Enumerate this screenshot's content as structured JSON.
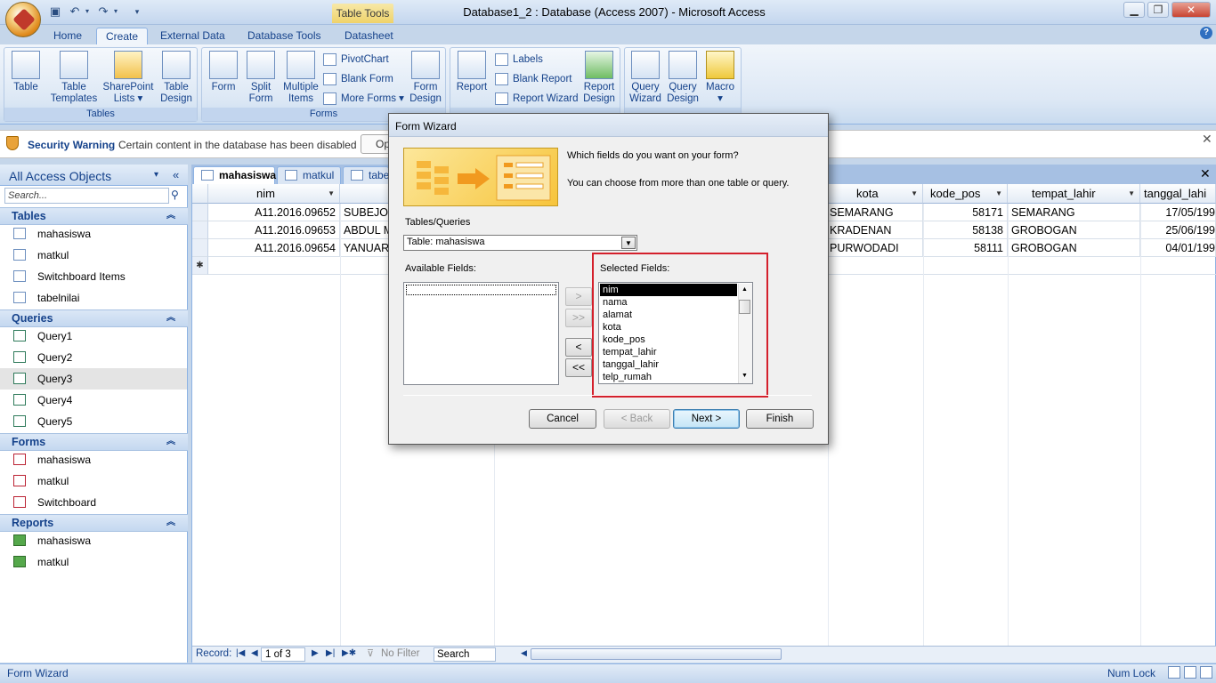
{
  "title_bar": {
    "context_tab": "Table Tools",
    "window_title": "Database1_2 : Database (Access 2007) - Microsoft Access"
  },
  "ribbon_tabs": [
    "Home",
    "Create",
    "External Data",
    "Database Tools",
    "Datasheet"
  ],
  "ribbon": {
    "tables": {
      "label": "Tables",
      "buttons": [
        {
          "l1": "Table",
          "l2": ""
        },
        {
          "l1": "Table",
          "l2": "Templates ▾"
        },
        {
          "l1": "SharePoint",
          "l2": "Lists ▾"
        },
        {
          "l1": "Table",
          "l2": "Design"
        }
      ]
    },
    "forms": {
      "label": "Forms",
      "big": [
        {
          "l1": "Form",
          "l2": ""
        },
        {
          "l1": "Split",
          "l2": "Form"
        },
        {
          "l1": "Multiple",
          "l2": "Items"
        }
      ],
      "small": [
        "PivotChart",
        "Blank Form",
        "More Forms ▾"
      ],
      "design": {
        "l1": "Form",
        "l2": "Design"
      }
    },
    "reports": {
      "big": {
        "l1": "Report",
        "l2": ""
      },
      "small": [
        "Labels",
        "Blank Report",
        "Report Wizard"
      ],
      "design": {
        "l1": "Report",
        "l2": "Design"
      }
    },
    "other": {
      "buttons": [
        {
          "l1": "Query",
          "l2": "Wizard"
        },
        {
          "l1": "Query",
          "l2": "Design"
        },
        {
          "l1": "Macro",
          "l2": "▾"
        }
      ]
    }
  },
  "security_bar": {
    "title": "Security Warning",
    "message": "Certain content in the database has been disabled",
    "options_button": "Op"
  },
  "nav_pane": {
    "title": "All Access Objects",
    "search_placeholder": "Search...",
    "sections": {
      "tables": {
        "label": "Tables",
        "items": [
          "mahasiswa",
          "matkul",
          "Switchboard Items",
          "tabelnilai"
        ]
      },
      "queries": {
        "label": "Queries",
        "items": [
          "Query1",
          "Query2",
          "Query3",
          "Query4",
          "Query5"
        ]
      },
      "forms": {
        "label": "Forms",
        "items": [
          "mahasiswa",
          "matkul",
          "Switchboard"
        ]
      },
      "reports": {
        "label": "Reports",
        "items": [
          "mahasiswa",
          "matkul"
        ]
      }
    }
  },
  "doc_tabs": [
    "mahasiswa",
    "matkul",
    "tabe"
  ],
  "datasheet": {
    "columns": {
      "nim": "nim",
      "kota": "kota",
      "kode_pos": "kode_pos",
      "tempat_lahir": "tempat_lahir",
      "tanggal_lahir": "tanggal_lahi"
    },
    "rows": [
      {
        "nim": "A11.2016.09652",
        "nama": "SUBEJO",
        "kota": "SEMARANG",
        "kode_pos": "58171",
        "tempat_lahir": "SEMARANG",
        "tanggal_lahir": "17/05/199"
      },
      {
        "nim": "A11.2016.09653",
        "nama": "ABDUL M",
        "kota": "KRADENAN",
        "kode_pos": "58138",
        "tempat_lahir": "GROBOGAN",
        "tanggal_lahir": "25/06/199"
      },
      {
        "nim": "A11.2016.09654",
        "nama": "YANUAR",
        "kota": "PURWODADI",
        "kode_pos": "58111",
        "tempat_lahir": "GROBOGAN",
        "tanggal_lahir": "04/01/199"
      }
    ],
    "new_row_marker": "✱"
  },
  "record_nav": {
    "label": "Record:",
    "position": "1 of 3",
    "filter": "No Filter",
    "search": "Search"
  },
  "status_bar": {
    "left": "Form Wizard",
    "numlock": "Num Lock"
  },
  "dialog": {
    "title": "Form Wizard",
    "question": "Which fields do you want on your form?",
    "hint": "You can choose from more than one table or query.",
    "tables_queries_label": "Tables/Queries",
    "tables_queries_value": "Table: mahasiswa",
    "available_label": "Available Fields:",
    "selected_label": "Selected Fields:",
    "selected_fields": [
      "nim",
      "nama",
      "alamat",
      "kota",
      "kode_pos",
      "tempat_lahir",
      "tanggal_lahir",
      "telp_rumah"
    ],
    "move_buttons": [
      ">",
      ">>",
      "<",
      "<<"
    ],
    "buttons": {
      "cancel": "Cancel",
      "back": "< Back",
      "next": "Next >",
      "finish": "Finish"
    }
  }
}
